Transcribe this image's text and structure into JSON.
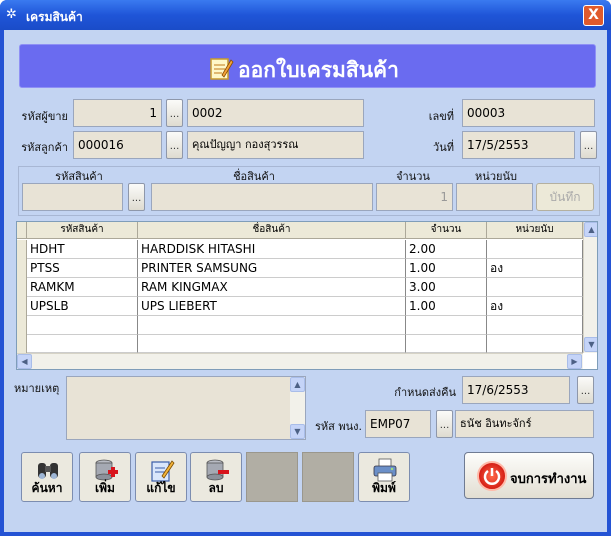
{
  "window": {
    "title": "เครมสินค้า",
    "close_glyph": "X"
  },
  "banner": {
    "title": "ออกใบเครมสินค้า",
    "icon": "notepad-icon"
  },
  "header": {
    "seller_id_label": "รหัสผู้ขาย",
    "seller_no": "1",
    "seller_code": "0002",
    "doc_no_label": "เลขที่",
    "doc_no": "00003",
    "customer_id_label": "รหัสลูกค้า",
    "customer_code": "000016",
    "customer_name": "คุณปัญญา กองสุวรรณ",
    "date_label": "วันที่",
    "date": "17/5/2553",
    "browse_label": "..."
  },
  "entry": {
    "product_code_label": "รหัสสินค้า",
    "product_name_label": "ชื่อสินค้า",
    "qty_label": "จำนวน",
    "unit_label": "หน่วยนับ",
    "qty_value": "1",
    "save_label": "บันทึก"
  },
  "grid": {
    "columns": [
      "รหัสสินค้า",
      "ชื่อสินค้า",
      "จำนวน",
      "หน่วยนับ"
    ],
    "rows": [
      [
        "HDHT",
        "HARDDISK HITASHI",
        "2.00",
        ""
      ],
      [
        "PTSS",
        "PRINTER SAMSUNG",
        "1.00",
        "อง"
      ],
      [
        "RAMKM",
        "RAM KINGMAX",
        "3.00",
        ""
      ],
      [
        "UPSLB",
        "UPS LIEBERT",
        "1.00",
        "อง"
      ],
      [
        "",
        "",
        "",
        ""
      ],
      [
        "",
        "",
        "",
        ""
      ]
    ]
  },
  "footer": {
    "remark_label": "หมายเหตุ",
    "return_date_label": "กำหนดส่งคืน",
    "return_date": "17/6/2553",
    "employee_label": "รหัส พนง.",
    "employee_code": "EMP07",
    "employee_name": "ธนัช อินทะจักร์"
  },
  "toolbar": {
    "search_label": "ค้นหา",
    "add_label": "เพิ่ม",
    "edit_label": "แก้ไข",
    "delete_label": "ลบ",
    "print_label": "พิมพ์",
    "exit_label": "จบการทำงาน"
  }
}
